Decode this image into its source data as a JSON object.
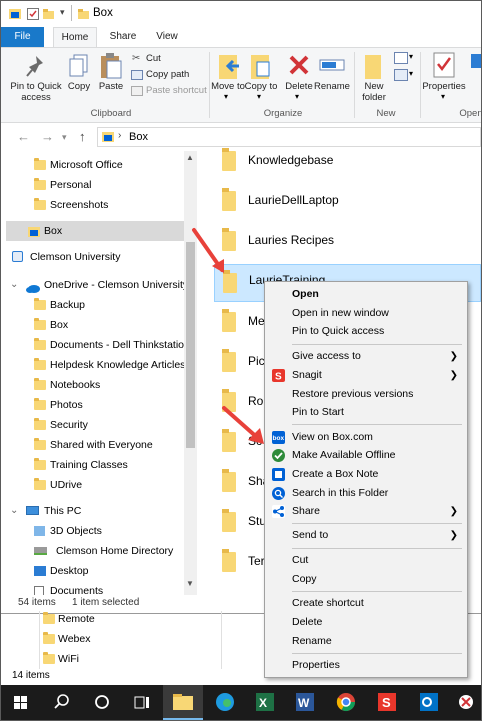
{
  "window": {
    "title": "Box"
  },
  "ribbon_tabs": [
    {
      "label": "File"
    },
    {
      "label": "Home"
    },
    {
      "label": "Share"
    },
    {
      "label": "View"
    }
  ],
  "ribbon": {
    "pin_quick_access": "Pin to Quick access",
    "copy": "Copy",
    "paste": "Paste",
    "cut": "Cut",
    "copy_path": "Copy path",
    "paste_shortcut": "Paste shortcut",
    "clipboard_group": "Clipboard",
    "move_to": "Move to",
    "copy_to": "Copy to",
    "delete": "Delete",
    "rename": "Rename",
    "organize_group": "Organize",
    "new_folder": "New folder",
    "new_group": "New",
    "properties": "Properties",
    "open_group": "Open"
  },
  "address": {
    "path_item": "Box"
  },
  "nav_pane": {
    "items": [
      {
        "label": "Microsoft Office"
      },
      {
        "label": "Personal"
      },
      {
        "label": "Screenshots"
      },
      {
        "label": "Box"
      },
      {
        "label": "Clemson University"
      },
      {
        "label": "OneDrive - Clemson University"
      },
      {
        "label": "Backup"
      },
      {
        "label": "Box"
      },
      {
        "label": "Documents - Dell Thinkstation"
      },
      {
        "label": "Helpdesk Knowledge Articles"
      },
      {
        "label": "Notebooks"
      },
      {
        "label": "Photos"
      },
      {
        "label": "Security"
      },
      {
        "label": "Shared with Everyone"
      },
      {
        "label": "Training Classes"
      },
      {
        "label": "UDrive"
      },
      {
        "label": "This PC"
      },
      {
        "label": "3D Objects"
      },
      {
        "label": "Clemson Home Directory"
      },
      {
        "label": "Desktop"
      },
      {
        "label": "Documents"
      }
    ]
  },
  "main_pane": {
    "items": [
      {
        "label": "Knowledgebase"
      },
      {
        "label": "LaurieDellLaptop"
      },
      {
        "label": "Lauries Recipes"
      },
      {
        "label": "LaurieTraining"
      },
      {
        "label": "Me"
      },
      {
        "label": "Pic"
      },
      {
        "label": "Ro"
      },
      {
        "label": "Sc"
      },
      {
        "label": "Sha"
      },
      {
        "label": "Stu"
      },
      {
        "label": "Ter"
      }
    ]
  },
  "status_bar": {
    "item_count": "54 items",
    "selected": "1 item selected"
  },
  "background_window": {
    "items": [
      {
        "label": "Remote"
      },
      {
        "label": "Webex"
      },
      {
        "label": "WiFi"
      }
    ],
    "status": "14 items"
  },
  "context_menu": {
    "items": [
      {
        "label": "Open"
      },
      {
        "label": "Open in new window"
      },
      {
        "label": "Pin to Quick access"
      },
      {
        "label": "Give access to"
      },
      {
        "label": "Snagit"
      },
      {
        "label": "Restore previous versions"
      },
      {
        "label": "Pin to Start"
      },
      {
        "label": "View on Box.com"
      },
      {
        "label": "Make Available Offline"
      },
      {
        "label": "Create a Box Note"
      },
      {
        "label": "Search in this Folder"
      },
      {
        "label": "Share"
      },
      {
        "label": "Send to"
      },
      {
        "label": "Cut"
      },
      {
        "label": "Copy"
      },
      {
        "label": "Create shortcut"
      },
      {
        "label": "Delete"
      },
      {
        "label": "Rename"
      },
      {
        "label": "Properties"
      }
    ],
    "box_icon_text": "box"
  },
  "colors": {
    "file_tab": "#1979ca",
    "selection": "#cce8ff",
    "nav_selection": "#d9d9d9",
    "annotation_arrow": "#e8413a",
    "taskbar": "#1b1b1b",
    "offline_check": "#2e8b3a"
  }
}
